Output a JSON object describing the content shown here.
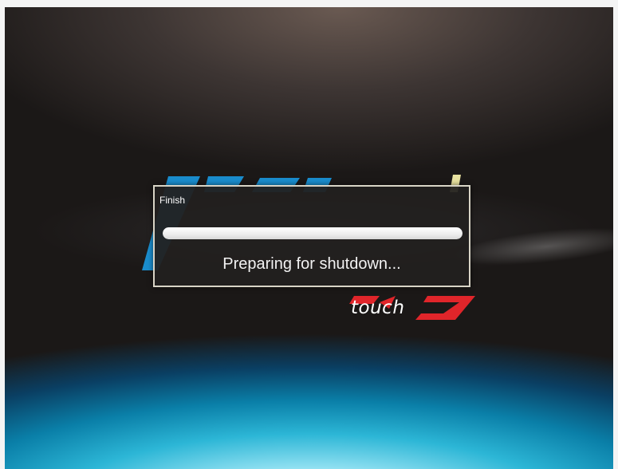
{
  "dialog": {
    "title": "Finish",
    "status": "Preparing for shutdown...",
    "progress": 1.0
  },
  "background_logo": {
    "text": "touch",
    "colors": {
      "blue": "#1a8ccc",
      "red": "#e0252a",
      "yellow": "#e8e2a0"
    }
  },
  "colors": {
    "dialog_bg": "#22201f",
    "dialog_border": "#d8d4c6",
    "progress_fill": "#eeeeee",
    "text": "#f2f2f2"
  }
}
